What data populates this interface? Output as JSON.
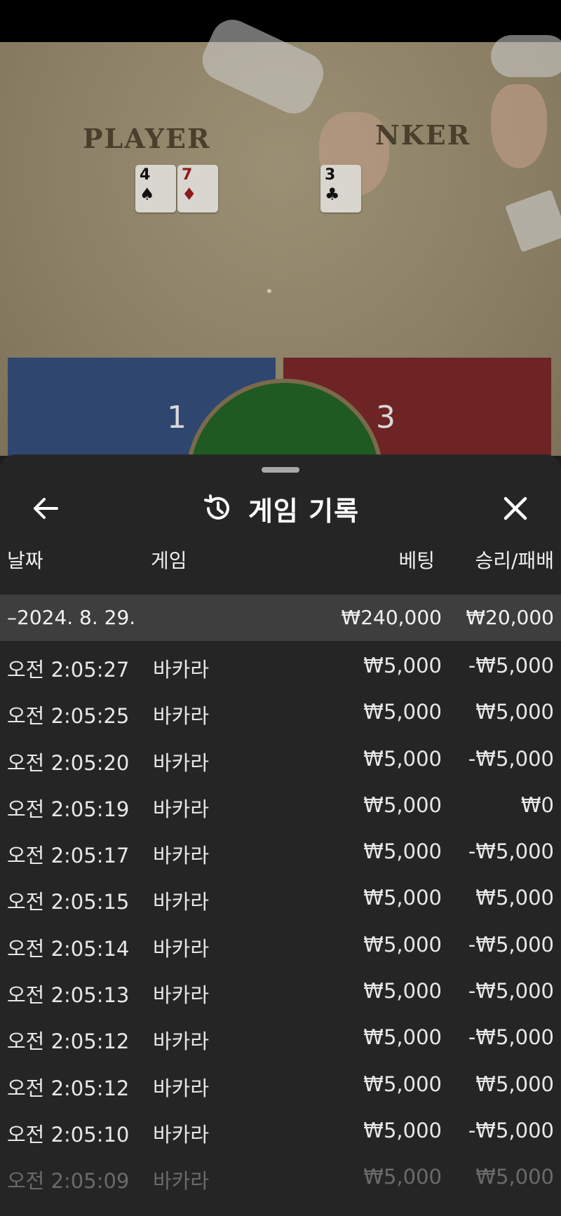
{
  "game_view": {
    "table_labels": {
      "player": "PLAYER",
      "banker": "NKER"
    },
    "player_cards": [
      {
        "rank": "4",
        "suit": "♠",
        "color": "black"
      },
      {
        "rank": "7",
        "suit": "♦",
        "color": "red"
      }
    ],
    "banker_cards": [
      {
        "rank": "3",
        "suit": "♣",
        "color": "black"
      }
    ],
    "player_score": "1",
    "banker_score": "3",
    "colors": {
      "player": "#2f466f",
      "banker": "#6e2424",
      "tie": "#1f5a22"
    }
  },
  "history_sheet": {
    "title": "게임 기록",
    "back_icon": "arrow-left-icon",
    "title_icon": "history-icon",
    "close_icon": "close-icon",
    "columns": {
      "date": "날짜",
      "game": "게임",
      "bet": "베팅",
      "result": "승리/패배"
    },
    "group": {
      "date": "–2024. 8. 29.",
      "bet_total": "₩240,000",
      "result_total": "₩20,000"
    },
    "rows": [
      {
        "time": "오전 2:05:27",
        "game": "바카라",
        "bet": "₩5,000",
        "result": "-₩5,000"
      },
      {
        "time": "오전 2:05:25",
        "game": "바카라",
        "bet": "₩5,000",
        "result": "₩5,000"
      },
      {
        "time": "오전 2:05:20",
        "game": "바카라",
        "bet": "₩5,000",
        "result": "-₩5,000"
      },
      {
        "time": "오전 2:05:19",
        "game": "바카라",
        "bet": "₩5,000",
        "result": "₩0"
      },
      {
        "time": "오전 2:05:17",
        "game": "바카라",
        "bet": "₩5,000",
        "result": "-₩5,000"
      },
      {
        "time": "오전 2:05:15",
        "game": "바카라",
        "bet": "₩5,000",
        "result": "₩5,000"
      },
      {
        "time": "오전 2:05:14",
        "game": "바카라",
        "bet": "₩5,000",
        "result": "-₩5,000"
      },
      {
        "time": "오전 2:05:13",
        "game": "바카라",
        "bet": "₩5,000",
        "result": "-₩5,000"
      },
      {
        "time": "오전 2:05:12",
        "game": "바카라",
        "bet": "₩5,000",
        "result": "-₩5,000"
      },
      {
        "time": "오전 2:05:12",
        "game": "바카라",
        "bet": "₩5,000",
        "result": "₩5,000"
      },
      {
        "time": "오전 2:05:10",
        "game": "바카라",
        "bet": "₩5,000",
        "result": "-₩5,000"
      },
      {
        "time": "오전 2:05:09",
        "game": "바카라",
        "bet": "₩5,000",
        "result": "₩5,000"
      }
    ]
  }
}
